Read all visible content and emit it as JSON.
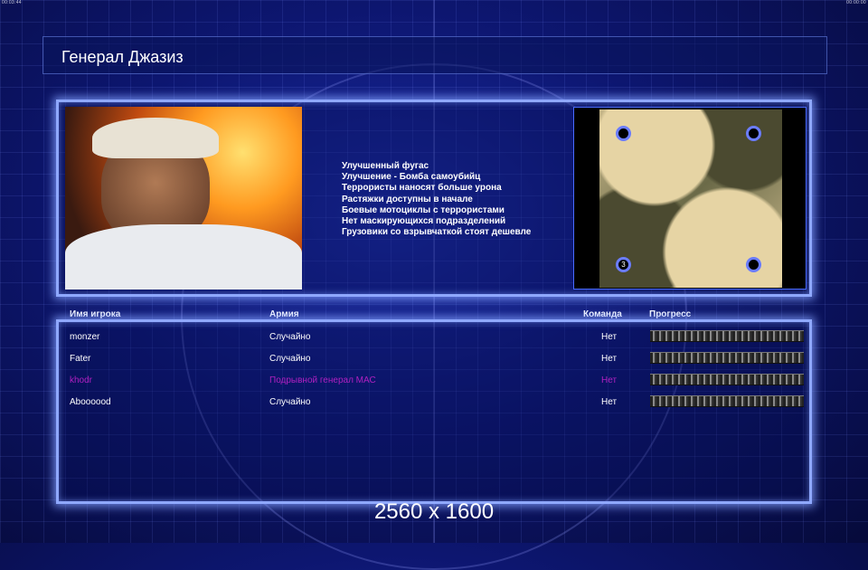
{
  "hud": {
    "left": "00:03:44",
    "right": "00:00:00"
  },
  "title": "Генерал Джазиз",
  "general_features": [
    "Улучшенный фугас",
    "Улучшение - Бомба самоубийц",
    "Террористы наносят больше урона",
    "Растяжки доступны в начале",
    "Боевые мотоциклы с террористами",
    "Нет маскирующихся подразделений",
    "Грузовики со взрывчаткой стоят дешевле"
  ],
  "map": {
    "start_label": "3"
  },
  "table": {
    "headers": {
      "player": "Имя игрока",
      "army": "Армия",
      "team": "Команда",
      "progress": "Прогресс"
    },
    "rows": [
      {
        "player": "monzer",
        "army": "Случайно",
        "team": "Нет",
        "progress": 0,
        "color": "#ffffff"
      },
      {
        "player": "Fater",
        "army": "Случайно",
        "team": "Нет",
        "progress": 0,
        "color": "#ffffff"
      },
      {
        "player": "khodr",
        "army": "Подрывной генерал МАС",
        "team": "Нет",
        "progress": 0,
        "color": "#b020c0"
      },
      {
        "player": "Aboooood",
        "army": "Случайно",
        "team": "Нет",
        "progress": 0,
        "color": "#ffffff"
      }
    ]
  },
  "resolution": "2560 x 1600"
}
